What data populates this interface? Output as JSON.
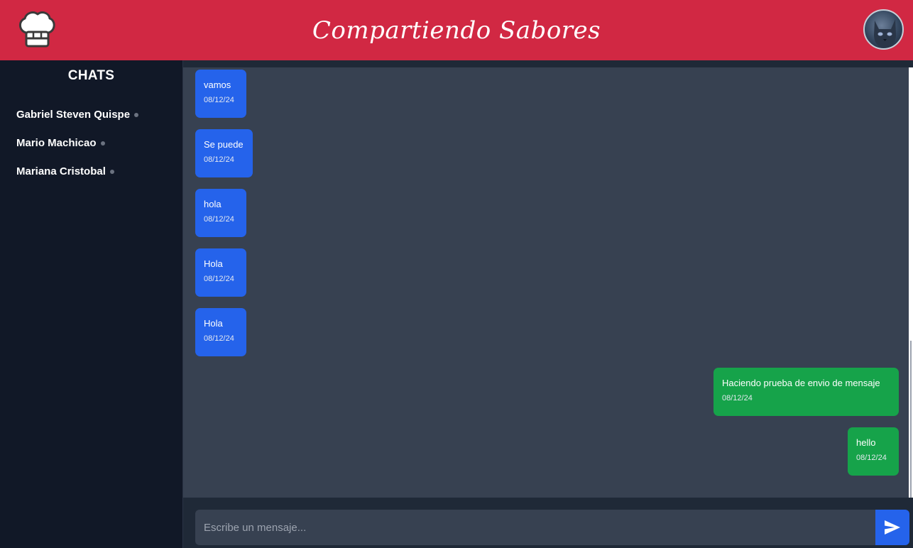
{
  "header": {
    "title": "Compartiendo Sabores",
    "logo_icon": "chef-hat-icon",
    "avatar_icon": "cat-avatar"
  },
  "sidebar": {
    "title": "CHATS",
    "chats": [
      {
        "name": "Gabriel Steven Quispe"
      },
      {
        "name": "Mario Machicao"
      },
      {
        "name": "Mariana Cristobal"
      }
    ]
  },
  "messages": [
    {
      "text": "vamos",
      "date": "08/12/24",
      "direction": "received"
    },
    {
      "text": "Se puede",
      "date": "08/12/24",
      "direction": "received"
    },
    {
      "text": "hola",
      "date": "08/12/24",
      "direction": "received"
    },
    {
      "text": "Hola",
      "date": "08/12/24",
      "direction": "received"
    },
    {
      "text": "Hola",
      "date": "08/12/24",
      "direction": "received"
    },
    {
      "text": "Haciendo prueba de envio de mensaje",
      "date": "08/12/24",
      "direction": "sent"
    },
    {
      "text": "hello",
      "date": "08/12/24",
      "direction": "sent"
    }
  ],
  "composer": {
    "placeholder": "Escribe un mensaje...",
    "value": "",
    "send_icon": "send-icon"
  },
  "colors": {
    "header": "#d12843",
    "sidebar": "#111827",
    "chat_area": "#374151",
    "received_bubble": "#2563eb",
    "sent_bubble": "#16a34a",
    "send_button": "#2563eb"
  }
}
